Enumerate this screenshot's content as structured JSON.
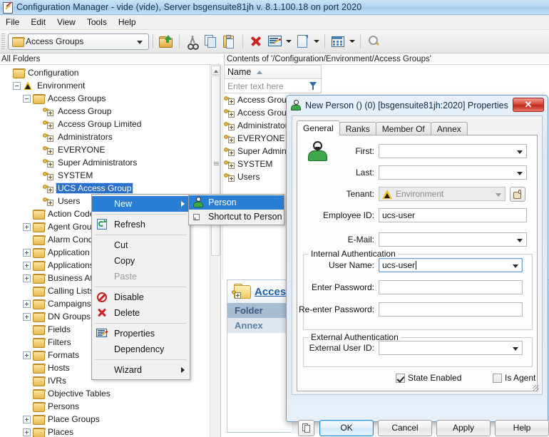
{
  "window": {
    "title": "Configuration Manager - vide  (vide), Server bsgensuite81jh v. 8.1.100.18 on port 2020",
    "icon": "config-manager-icon"
  },
  "menubar": {
    "items": [
      {
        "label": "File"
      },
      {
        "label": "Edit"
      },
      {
        "label": "View"
      },
      {
        "label": "Tools"
      },
      {
        "label": "Help"
      }
    ]
  },
  "toolbar": {
    "folder_combo": {
      "value": "Access Groups",
      "icon": "folder-icon"
    },
    "buttons": [
      {
        "name": "up-one-level",
        "icon": "open-folder-up-icon"
      },
      {
        "name": "cut",
        "icon": "scissors-icon"
      },
      {
        "name": "copy",
        "icon": "copy-icon"
      },
      {
        "name": "paste",
        "icon": "paste-icon"
      },
      {
        "name": "delete",
        "icon": "red-x-icon"
      },
      {
        "name": "properties",
        "icon": "properties-icon"
      },
      {
        "name": "new",
        "icon": "new-document-icon"
      },
      {
        "name": "view-options",
        "icon": "grid-view-icon"
      },
      {
        "name": "search",
        "icon": "magnifier-icon"
      }
    ]
  },
  "panes": {
    "left_label": "All Folders",
    "right_label": "Contents of '/Configuration/Environment/Access Groups'"
  },
  "tree": {
    "items": [
      {
        "label": "Configuration",
        "depth": 0,
        "icon": "folder-icon",
        "expander": "none",
        "selected": false
      },
      {
        "label": "Environment",
        "depth": 1,
        "icon": "tenant-icon",
        "expander": "minus",
        "selected": false
      },
      {
        "label": "Access Groups",
        "depth": 2,
        "icon": "folder-icon",
        "expander": "minus",
        "selected": false
      },
      {
        "label": "Access Group",
        "depth": 3,
        "icon": "access-group-icon",
        "expander": "none",
        "selected": false
      },
      {
        "label": "Access Group Limited",
        "depth": 3,
        "icon": "access-group-icon",
        "expander": "none",
        "selected": false
      },
      {
        "label": "Administrators",
        "depth": 3,
        "icon": "access-group-icon",
        "expander": "none",
        "selected": false
      },
      {
        "label": "EVERYONE",
        "depth": 3,
        "icon": "access-group-icon",
        "expander": "none",
        "selected": false
      },
      {
        "label": "Super Administrators",
        "depth": 3,
        "icon": "access-group-icon",
        "expander": "none",
        "selected": false
      },
      {
        "label": "SYSTEM",
        "depth": 3,
        "icon": "access-group-icon",
        "expander": "none",
        "selected": false
      },
      {
        "label": "UCS Access Group",
        "depth": 3,
        "icon": "access-group-icon",
        "expander": "none",
        "selected": true
      },
      {
        "label": "Users",
        "depth": 3,
        "icon": "access-group-icon",
        "expander": "none",
        "selected": false
      },
      {
        "label": "Action Codes",
        "depth": 2,
        "icon": "folder-icon",
        "expander": "none",
        "selected": false
      },
      {
        "label": "Agent Groups",
        "depth": 2,
        "icon": "folder-icon",
        "expander": "plus",
        "selected": false
      },
      {
        "label": "Alarm Conditions",
        "depth": 2,
        "icon": "folder-icon",
        "expander": "none",
        "selected": false
      },
      {
        "label": "Application Templates",
        "depth": 2,
        "icon": "folder-icon",
        "expander": "plus",
        "selected": false
      },
      {
        "label": "Applications",
        "depth": 2,
        "icon": "folder-icon",
        "expander": "plus",
        "selected": false
      },
      {
        "label": "Business Attributes",
        "depth": 2,
        "icon": "folder-icon",
        "expander": "plus",
        "selected": false
      },
      {
        "label": "Calling Lists",
        "depth": 2,
        "icon": "folder-icon",
        "expander": "none",
        "selected": false
      },
      {
        "label": "Campaigns",
        "depth": 2,
        "icon": "folder-icon",
        "expander": "plus",
        "selected": false
      },
      {
        "label": "DN Groups",
        "depth": 2,
        "icon": "folder-icon",
        "expander": "plus",
        "selected": false
      },
      {
        "label": "Fields",
        "depth": 2,
        "icon": "folder-icon",
        "expander": "none",
        "selected": false
      },
      {
        "label": "Filters",
        "depth": 2,
        "icon": "folder-icon",
        "expander": "none",
        "selected": false
      },
      {
        "label": "Formats",
        "depth": 2,
        "icon": "folder-icon",
        "expander": "plus",
        "selected": false
      },
      {
        "label": "Hosts",
        "depth": 2,
        "icon": "folder-icon",
        "expander": "none",
        "selected": false
      },
      {
        "label": "IVRs",
        "depth": 2,
        "icon": "folder-icon",
        "expander": "none",
        "selected": false
      },
      {
        "label": "Objective Tables",
        "depth": 2,
        "icon": "folder-icon",
        "expander": "none",
        "selected": false
      },
      {
        "label": "Persons",
        "depth": 2,
        "icon": "folder-icon",
        "expander": "none",
        "selected": false
      },
      {
        "label": "Place Groups",
        "depth": 2,
        "icon": "folder-icon",
        "expander": "plus",
        "selected": false
      },
      {
        "label": "Places",
        "depth": 2,
        "icon": "folder-icon",
        "expander": "plus",
        "selected": false
      }
    ]
  },
  "list": {
    "column_header": "Name",
    "filter_placeholder": "Enter text here",
    "rows": [
      {
        "label": "Access Group"
      },
      {
        "label": "Access Group Limited"
      },
      {
        "label": "Administrators"
      },
      {
        "label": "EVERYONE"
      },
      {
        "label": "Super Administrators"
      },
      {
        "label": "SYSTEM"
      },
      {
        "label": "Users"
      }
    ]
  },
  "detail": {
    "title": "Access Group",
    "tabs": [
      {
        "label": "Folder",
        "active": true
      },
      {
        "label": "Annex",
        "active": false
      }
    ]
  },
  "context_menu": {
    "items": [
      {
        "label": "New",
        "icon": null,
        "submenu": true,
        "highlighted": true,
        "disabled": false
      },
      {
        "type": "separator"
      },
      {
        "label": "Refresh",
        "icon": "refresh-icon",
        "submenu": false,
        "highlighted": false,
        "disabled": false
      },
      {
        "type": "separator"
      },
      {
        "label": "Cut",
        "icon": null,
        "submenu": false,
        "highlighted": false,
        "disabled": false
      },
      {
        "label": "Copy",
        "icon": null,
        "submenu": false,
        "highlighted": false,
        "disabled": false
      },
      {
        "label": "Paste",
        "icon": null,
        "submenu": false,
        "highlighted": false,
        "disabled": true
      },
      {
        "type": "separator"
      },
      {
        "label": "Disable",
        "icon": "disable-icon",
        "submenu": false,
        "highlighted": false,
        "disabled": false
      },
      {
        "label": "Delete",
        "icon": "delete-icon",
        "submenu": false,
        "highlighted": false,
        "disabled": false
      },
      {
        "type": "separator"
      },
      {
        "label": "Properties",
        "icon": "properties-icon",
        "submenu": false,
        "highlighted": false,
        "disabled": false
      },
      {
        "label": "Dependency",
        "icon": null,
        "submenu": false,
        "highlighted": false,
        "disabled": false
      },
      {
        "type": "separator"
      },
      {
        "label": "Wizard",
        "icon": null,
        "submenu": true,
        "highlighted": false,
        "disabled": false
      }
    ],
    "submenu": {
      "items": [
        {
          "label": "Person",
          "icon": "person-icon",
          "highlighted": true
        },
        {
          "label": "Shortcut to Person",
          "icon": "shortcut-icon",
          "highlighted": false
        }
      ]
    }
  },
  "dialog": {
    "title": "New Person  () (0) [bsgensuite81jh:2020] Properties",
    "close_label": "✕",
    "tabs": [
      {
        "label": "General",
        "active": true
      },
      {
        "label": "Ranks",
        "active": false
      },
      {
        "label": "Member Of",
        "active": false
      },
      {
        "label": "Annex",
        "active": false
      }
    ],
    "fields": {
      "first_label": "First:",
      "first_value": "",
      "last_label": "Last:",
      "last_value": "",
      "tenant_label": "Tenant:",
      "tenant_value": "Environment",
      "employee_id_label": "Employee ID:",
      "employee_id_value": "ucs-user",
      "email_label": "E-Mail:",
      "email_value": "",
      "internal_auth_group": "Internal Authentication",
      "user_name_label": "User Name:",
      "user_name_value": "ucs-user",
      "enter_password_label": "Enter Password:",
      "enter_password_value": "",
      "reenter_password_label": "Re-enter Password:",
      "reenter_password_value": "",
      "external_auth_group": "External Authentication",
      "external_user_id_label": "External User ID:",
      "external_user_id_value": ""
    },
    "checkboxes": [
      {
        "label": "State Enabled",
        "checked": true
      },
      {
        "label": "Is Agent",
        "checked": false
      }
    ],
    "buttons": [
      {
        "label": "OK",
        "default": true
      },
      {
        "label": "Cancel",
        "default": false
      },
      {
        "label": "Apply",
        "default": false
      },
      {
        "label": "Help",
        "default": false
      }
    ]
  },
  "colors": {
    "titlebar": "#b4d6ef",
    "selection": "#2a6fc9",
    "menu_highlight": "#2a7fd4",
    "detail_title": "#1c5fa8",
    "close_button": "#c0271c"
  }
}
